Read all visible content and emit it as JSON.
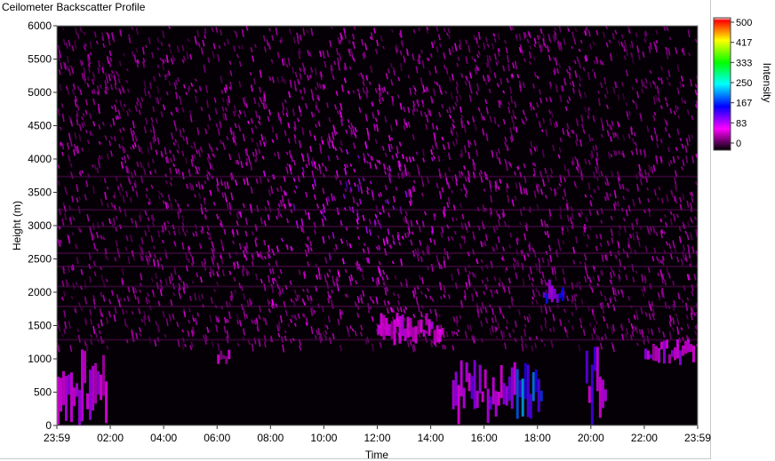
{
  "chart_data": {
    "type": "heatmap",
    "title": "Ceilometer Backscatter Profile",
    "xlabel": "Time",
    "ylabel": "Height (m)",
    "x_ticks": [
      "23:59",
      "02:00",
      "04:00",
      "06:00",
      "08:00",
      "10:00",
      "12:00",
      "14:00",
      "16:00",
      "18:00",
      "20:00",
      "22:00",
      "23:59"
    ],
    "y_ticks": [
      0,
      500,
      1000,
      1500,
      2000,
      2500,
      3000,
      3500,
      4000,
      4500,
      5000,
      5500,
      6000
    ],
    "ylim": [
      0,
      6000
    ],
    "xlim_hours": [
      0,
      24
    ],
    "colorbar": {
      "label": "Intensity",
      "ticks": [
        "500",
        "417",
        "333",
        "250",
        "167",
        "83",
        "0"
      ],
      "range": [
        0,
        500
      ],
      "colors": [
        "#000000",
        "#ff00ff",
        "#0000ff",
        "#00ffff",
        "#00ff00",
        "#ffff00",
        "#ff0000",
        "#ffffff"
      ]
    },
    "features": [
      {
        "hours": [
          0.0,
          1.9
        ],
        "height": [
          0,
          1200
        ],
        "intensity": 95
      },
      {
        "hours": [
          6.0,
          6.5
        ],
        "height": [
          900,
          1200
        ],
        "intensity": 75
      },
      {
        "hours": [
          14.8,
          17.2
        ],
        "height": [
          0,
          1000
        ],
        "intensity": 110
      },
      {
        "hours": [
          17.2,
          18.2
        ],
        "height": [
          0,
          1000
        ],
        "intensity": 190
      },
      {
        "hours": [
          18.2,
          19.0
        ],
        "height": [
          1800,
          2200
        ],
        "intensity": 150
      },
      {
        "hours": [
          19.8,
          20.6
        ],
        "height": [
          0,
          1200
        ],
        "intensity": 120
      },
      {
        "hours": [
          22.0,
          23.9
        ],
        "height": [
          900,
          1300
        ],
        "intensity": 100
      },
      {
        "hours": [
          12.0,
          14.5
        ],
        "height": [
          1200,
          1700
        ],
        "intensity": 85
      }
    ]
  }
}
